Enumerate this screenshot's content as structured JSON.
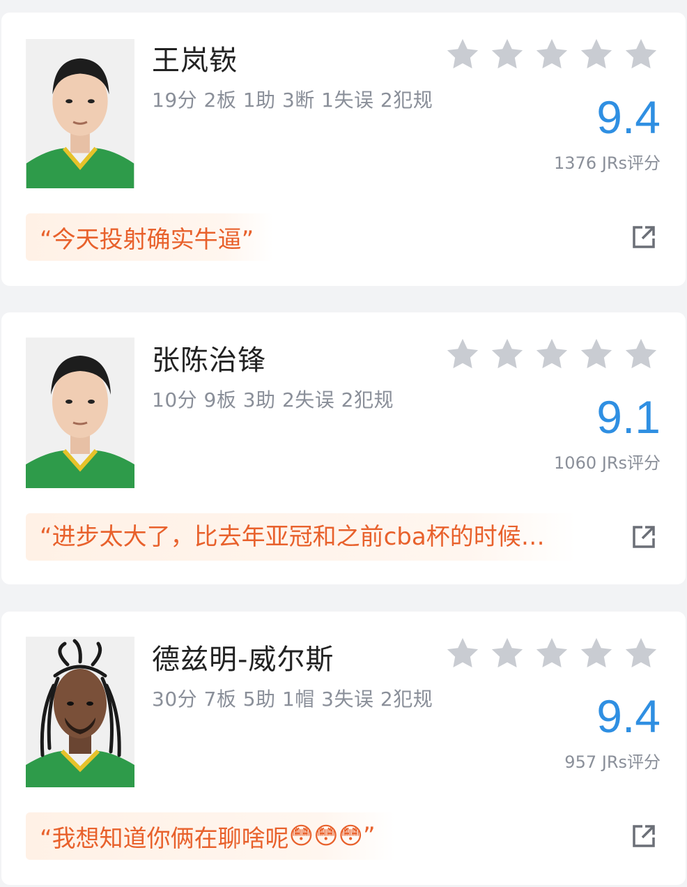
{
  "players": [
    {
      "name": "王岚嵚",
      "stats": "19分 2板 1助 3断 1失误 2犯规",
      "score": "9.4",
      "raters": "1376 JRs评分",
      "stars": 5,
      "comment": "“今天投射确实牛逼”"
    },
    {
      "name": "张陈治锋",
      "stats": "10分 9板 3助 2失误 2犯规",
      "score": "9.1",
      "raters": "1060 JRs评分",
      "stars": 5,
      "comment": "“进步太大了，比去年亚冠和之前cba杯的时候…"
    },
    {
      "name": "德兹明-威尔斯",
      "stats": "30分 7板 5助 1帽 3失误 2犯规",
      "score": "9.4",
      "raters": "957 JRs评分",
      "stars": 5,
      "comment": "“我想知道你俩在聊啥呢",
      "comment_emojis": "😳😳😳",
      "comment_end": "”"
    }
  ],
  "colors": {
    "star": "#c9ccd2",
    "score": "#2f8fe2",
    "comment_text": "#e8612c",
    "comment_bg": "#fff1e6",
    "jersey": "#2e9b4a"
  },
  "icons": {
    "star": "star-icon",
    "share": "external-share-icon"
  }
}
